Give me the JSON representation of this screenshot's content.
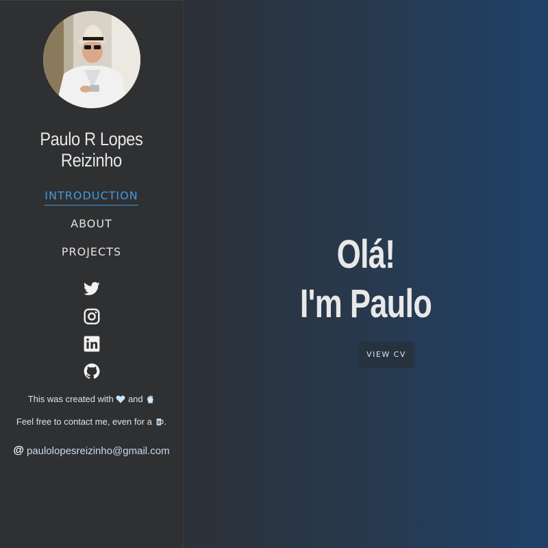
{
  "profile": {
    "name_line1": "Paulo R Lopes",
    "name_line2": "Reizinho"
  },
  "nav": {
    "items": [
      {
        "label": "INTRODUCTION",
        "active": true
      },
      {
        "label": "ABOUT",
        "active": false
      },
      {
        "label": "PROJECTS",
        "active": false
      }
    ]
  },
  "social": {
    "icons": [
      "twitter-icon",
      "instagram-icon",
      "linkedin-icon",
      "github-icon"
    ]
  },
  "footer": {
    "created_prefix": "This was created with",
    "created_mid": "and",
    "contact_text": "Feel free to contact me, even for a",
    "contact_suffix": ".",
    "email_at": "@",
    "email": "paulolopesreizinho@gmail.com"
  },
  "hero": {
    "line1": "Olá!",
    "line2": "I'm Paulo",
    "cv_button": "VIEW CV"
  },
  "colors": {
    "sidebar_bg": "#2f3032",
    "accent": "#3f9ae0",
    "main_gradient_start": "#2c3138",
    "main_gradient_end": "#1f4168"
  }
}
